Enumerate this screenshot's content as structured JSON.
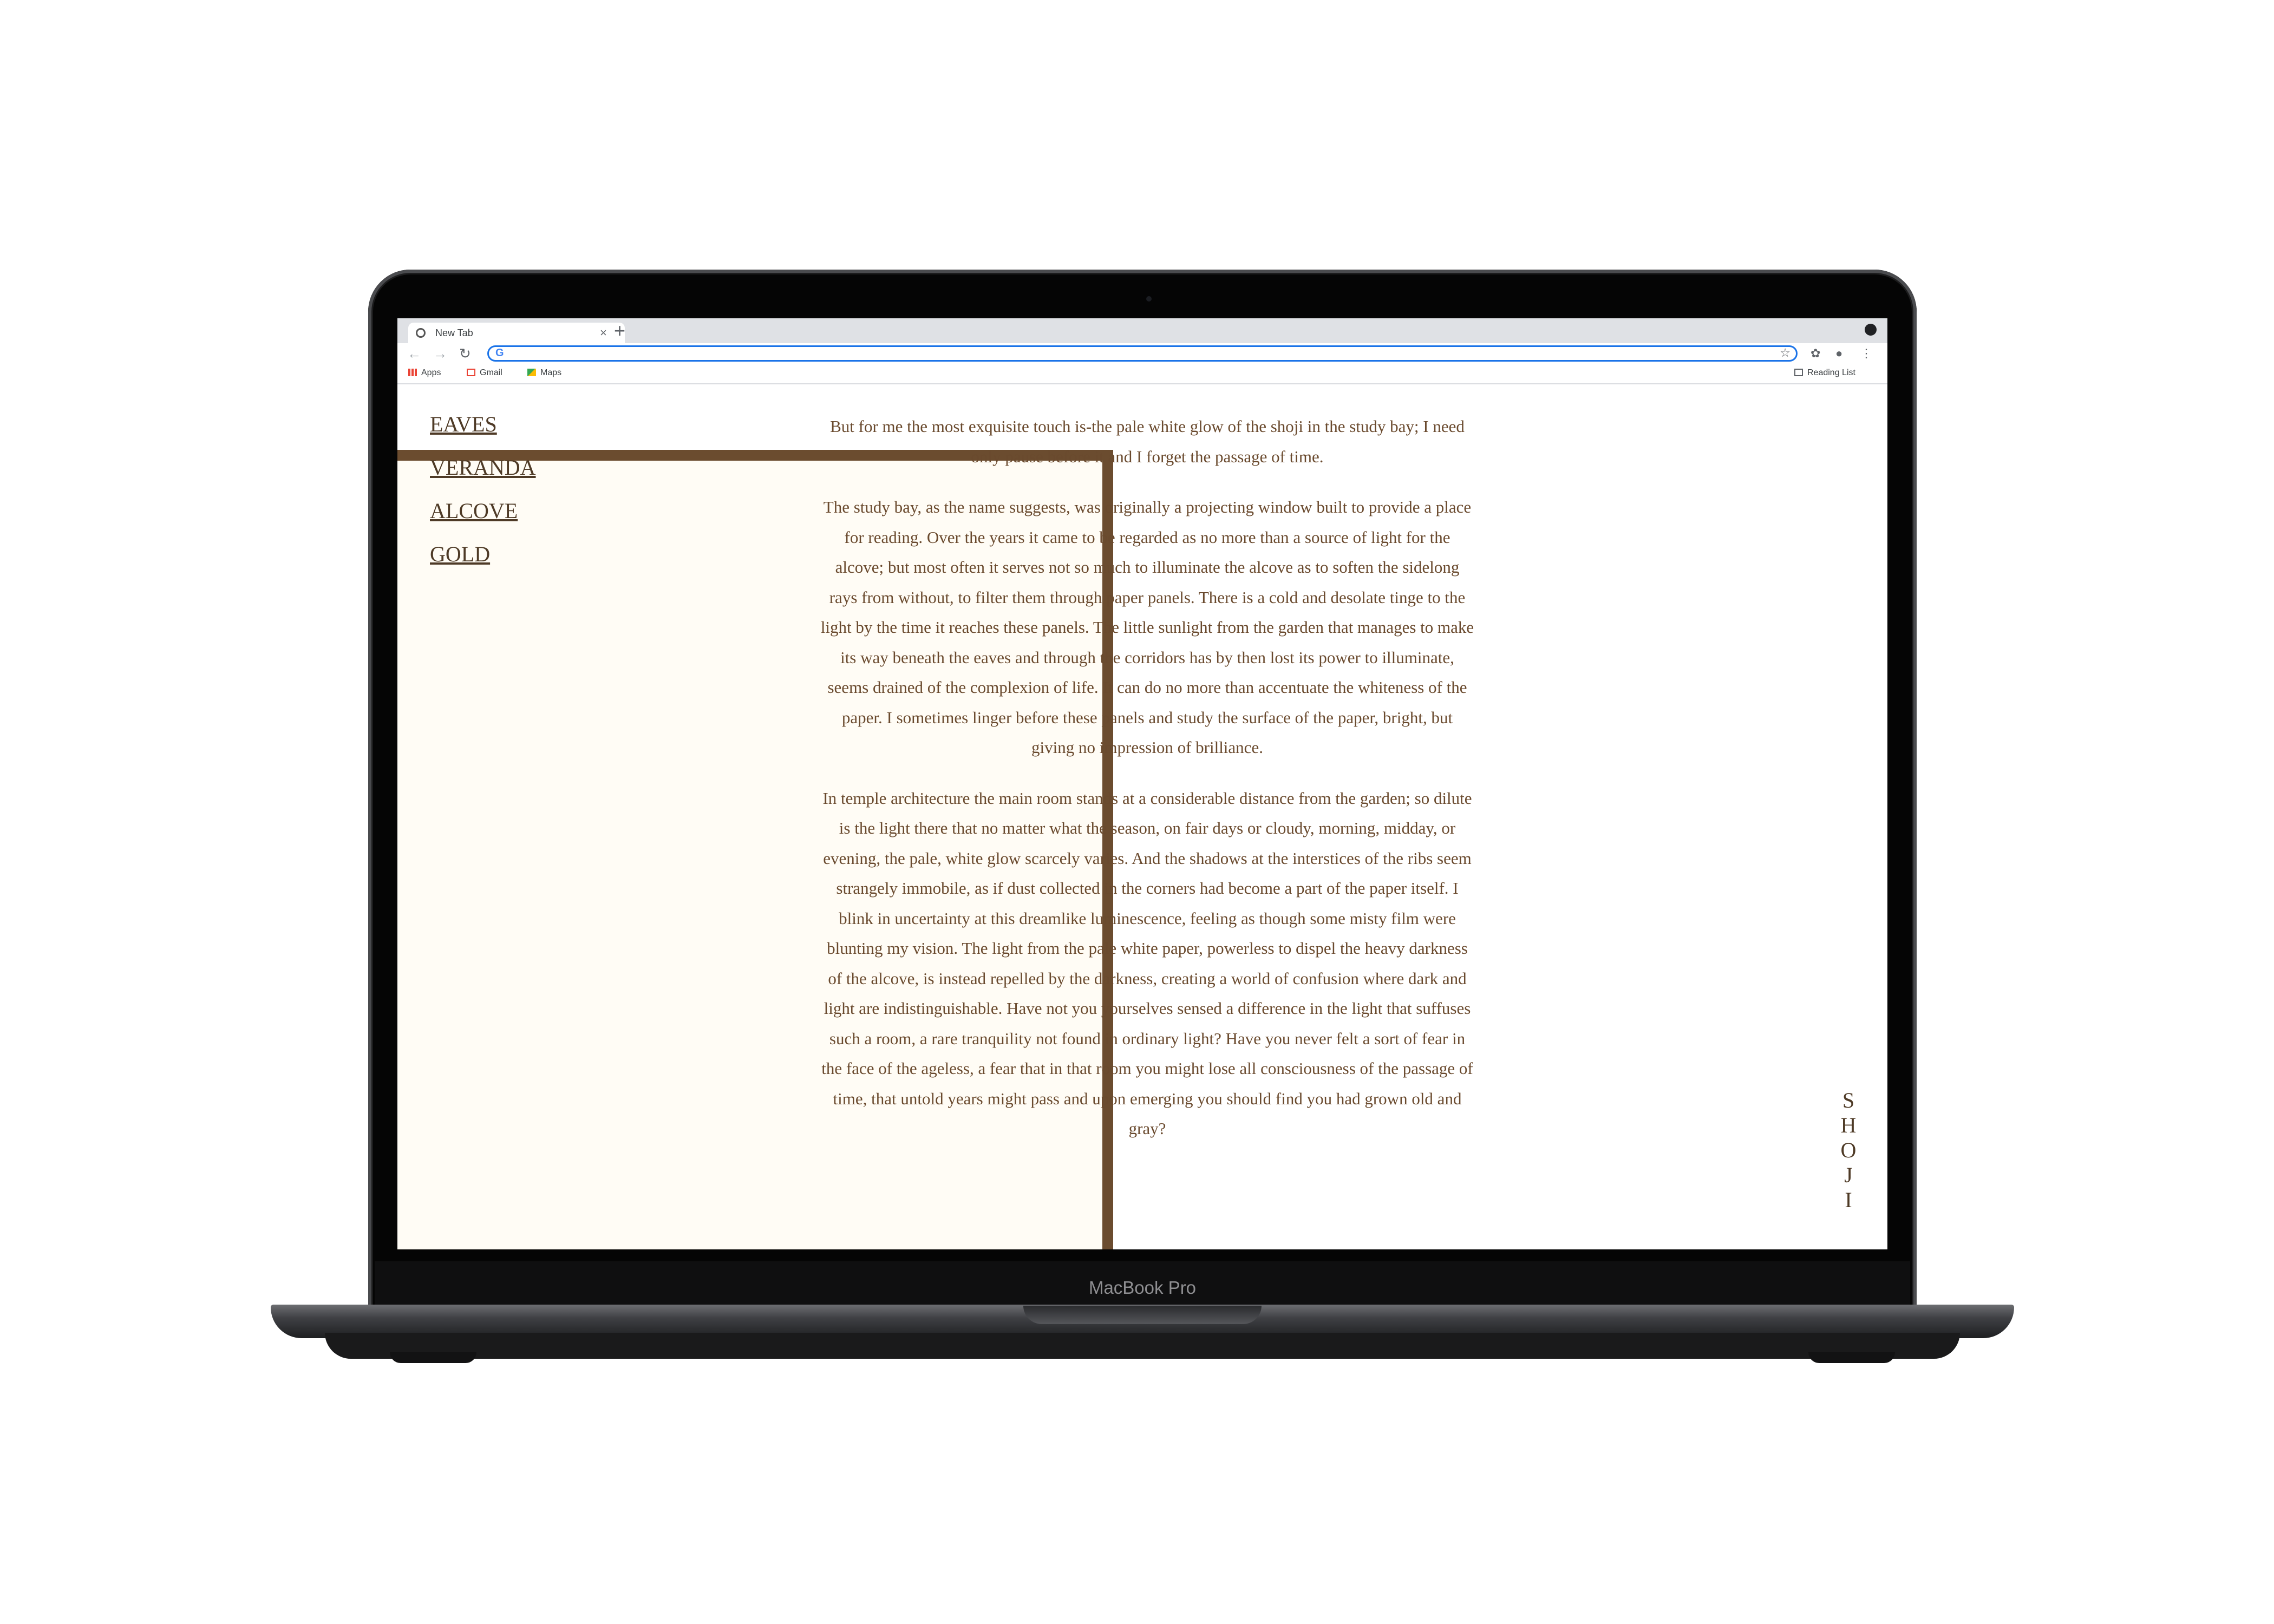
{
  "device": {
    "label": "MacBook Pro"
  },
  "browser": {
    "tab_title": "New Tab",
    "tab_close": "×",
    "new_tab": "+",
    "omnibox_value": "",
    "bookmarks": [
      "Apps",
      "Gmail",
      "Maps"
    ],
    "reading_list": "Reading List",
    "accent_color": "#1a73e8"
  },
  "site": {
    "nav": [
      "EAVES",
      "VERANDA",
      "ALCOVE",
      "GOLD"
    ],
    "vertical_title": [
      "S",
      "H",
      "O",
      "J",
      "I"
    ],
    "paragraphs": [
      "But for me the most exquisite touch is-the pale white glow of the shoji in the study bay; I need only pause before it and I forget the passage of time.",
      "The study bay, as the name suggests, was originally a projecting window built to provide a place for reading. Over the years it came to be regarded as no more than a source of light for the alcove; but most often it serves not so much to illuminate the alcove as to soften the sidelong rays from without, to filter them through paper panels. There is a cold and desolate tinge to the light by the time it reaches these panels. The little sunlight from the garden that manages to make its way beneath the eaves and through the corridors has by then lost its power to illuminate, seems drained of the complexion of life. It can do no more than accentuate the whiteness of the paper. I sometimes linger before these panels and study the surface of the paper, bright, but giving no impression of brilliance.",
      "In temple architecture the main room stands at a considerable distance from the garden; so dilute is the light there that no matter what the season, on fair days or cloudy, morning, midday, or evening, the pale, white glow scarcely varies. And the shadows at the interstices of the ribs seem strangely immobile, as if dust collected in the corners had become a part of the paper itself. I blink in uncertainty at this dreamlike luminescence, feeling as though some misty film were blunting my vision. The light from the pale white paper, powerless to dispel the heavy darkness of the alcove, is instead repelled by the darkness, creating a world of confusion where dark and light are indistinguishable. Have not you yourselves sensed a difference in the light that suffuses such a room, a rare tranquility not found in ordinary light? Have you never felt a sort of fear in the face of the ageless, a fear that in that room you might lose all consciousness of the passage of time, that untold years might pass and upon emerging you should find you had grown old and gray?"
    ],
    "colors": {
      "accent": "#6b4c2f",
      "panel": "#fffcf5",
      "text": "#6a4a2e"
    }
  }
}
